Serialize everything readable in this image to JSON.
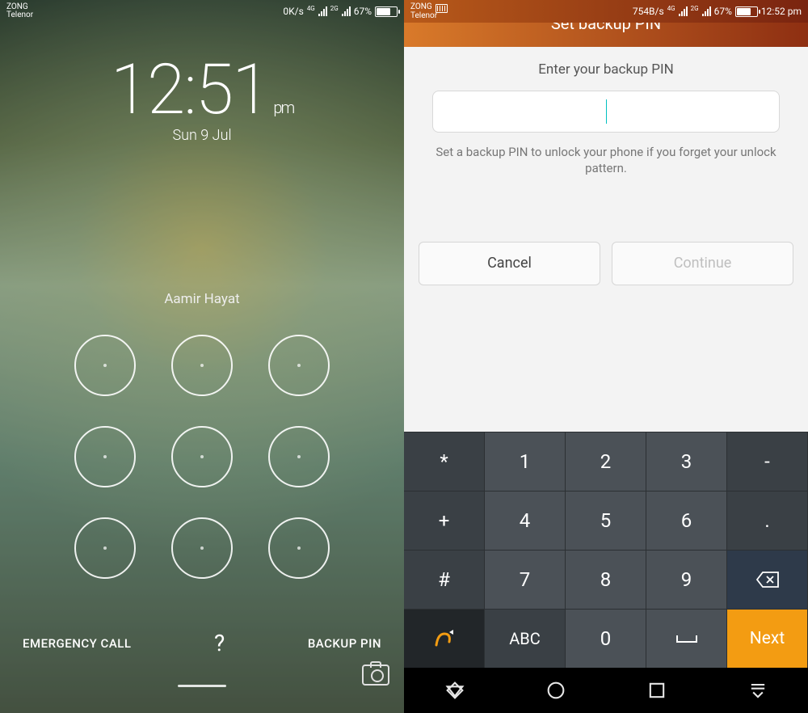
{
  "left": {
    "statusbar": {
      "carrier1": "ZONG",
      "carrier2": "Telenor",
      "data_speed": "0K/s",
      "net1_label": "4G",
      "net2_label": "2G",
      "battery_pct": "67%",
      "battery_fill_pct": 67
    },
    "clock": {
      "time": "12:51",
      "ampm": "pm",
      "date": "Sun 9 Jul"
    },
    "owner": "Aamir Hayat",
    "bottom": {
      "emergency": "EMERGENCY CALL",
      "help": "?",
      "backup": "BACKUP PIN"
    }
  },
  "right": {
    "statusbar": {
      "carrier1": "ZONG",
      "carrier2": "Telenor",
      "data_speed": "754B/s",
      "net1_label": "4G",
      "net2_label": "2G",
      "battery_pct": "67%",
      "battery_fill_pct": 67,
      "time": "12:52 pm"
    },
    "appbar_title": "Set backup PIN",
    "prompt": "Enter your backup PIN",
    "hint": "Set a backup PIN to unlock your phone if you forget your unlock pattern.",
    "actions": {
      "cancel": "Cancel",
      "continue": "Continue"
    },
    "keys": {
      "r1": [
        "*",
        "1",
        "2",
        "3",
        "-"
      ],
      "r2": [
        "+",
        "4",
        "5",
        "6",
        "."
      ],
      "r3": [
        "#",
        "7",
        "8",
        "9"
      ],
      "r4_abc": "ABC",
      "r4_zero": "0",
      "r4_space": "␣",
      "next": "Next"
    }
  }
}
